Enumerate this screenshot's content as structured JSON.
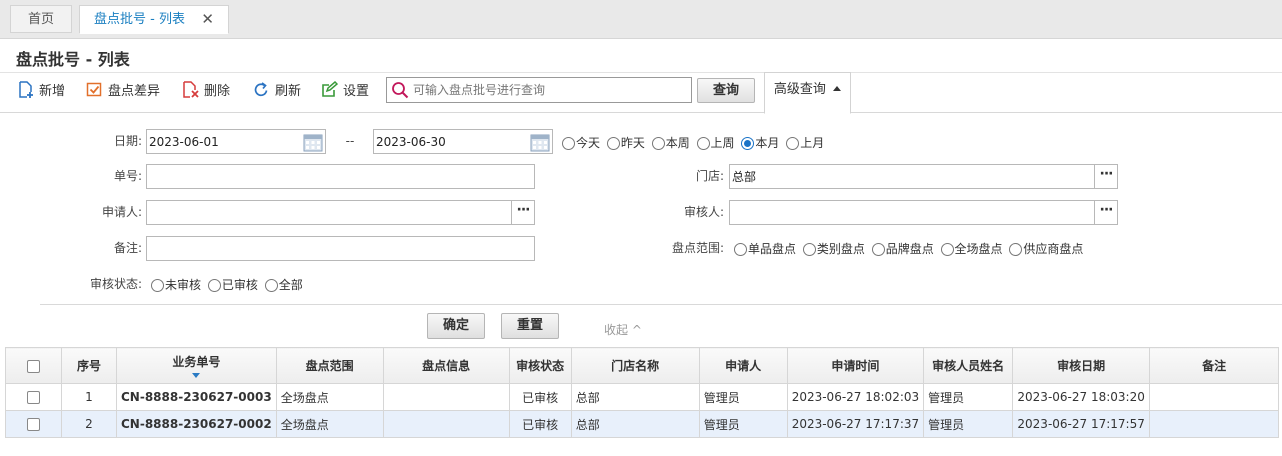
{
  "tabs": {
    "home": "首页",
    "active": "盘点批号 - 列表",
    "close": "✕"
  },
  "page_title": "盘点批号 - 列表",
  "toolbar": {
    "add": "新增",
    "diff": "盘点差异",
    "delete": "删除",
    "refresh": "刷新",
    "settings": "设置",
    "search_placeholder": "可输入盘点批号进行查询",
    "query": "查询",
    "advanced": "高级查询"
  },
  "form": {
    "date_label": "日期:",
    "date_from": "2023-06-01",
    "date_sep": "--",
    "date_to": "2023-06-30",
    "date_options": [
      "今天",
      "昨天",
      "本周",
      "上周",
      "本月",
      "上月"
    ],
    "order_label": "单号:",
    "order_value": "",
    "store_label": "门店:",
    "store_value": "总部",
    "applicant_label": "申请人:",
    "applicant_value": "",
    "reviewer_label": "审核人:",
    "reviewer_value": "",
    "remark_label": "备注:",
    "remark_value": "",
    "scope_label": "盘点范围:",
    "scope_options": [
      "单品盘点",
      "类别盘点",
      "品牌盘点",
      "全场盘点",
      "供应商盘点"
    ],
    "status_label": "审核状态:",
    "status_options": [
      "未审核",
      "已审核",
      "全部"
    ],
    "confirm": "确定",
    "reset": "重置",
    "collapse": "收起 ^"
  },
  "table": {
    "headers": [
      "序号",
      "业务单号",
      "盘点范围",
      "盘点信息",
      "审核状态",
      "门店名称",
      "申请人",
      "申请时间",
      "审核人员姓名",
      "审核日期",
      "备注"
    ],
    "rows": [
      [
        "1",
        "CN-8888-230627-0003",
        "全场盘点",
        "",
        "已审核",
        "总部",
        "管理员",
        "2023-06-27 18:02:03",
        "管理员",
        "2023-06-27 18:03:20",
        ""
      ],
      [
        "2",
        "CN-8888-230627-0002",
        "全场盘点",
        "",
        "已审核",
        "总部",
        "管理员",
        "2023-06-27 17:17:37",
        "管理员",
        "2023-06-27 17:17:57",
        ""
      ]
    ]
  },
  "icons": [
    "add-icon",
    "diff-icon",
    "delete-icon",
    "refresh-icon",
    "settings-icon",
    "search-icon",
    "calendar-icon",
    "ellipsis-icon"
  ],
  "colors": {
    "link": "#1c6fb0",
    "active_tab": "#1a7fc1",
    "selected_row": "#e8f0fb"
  }
}
